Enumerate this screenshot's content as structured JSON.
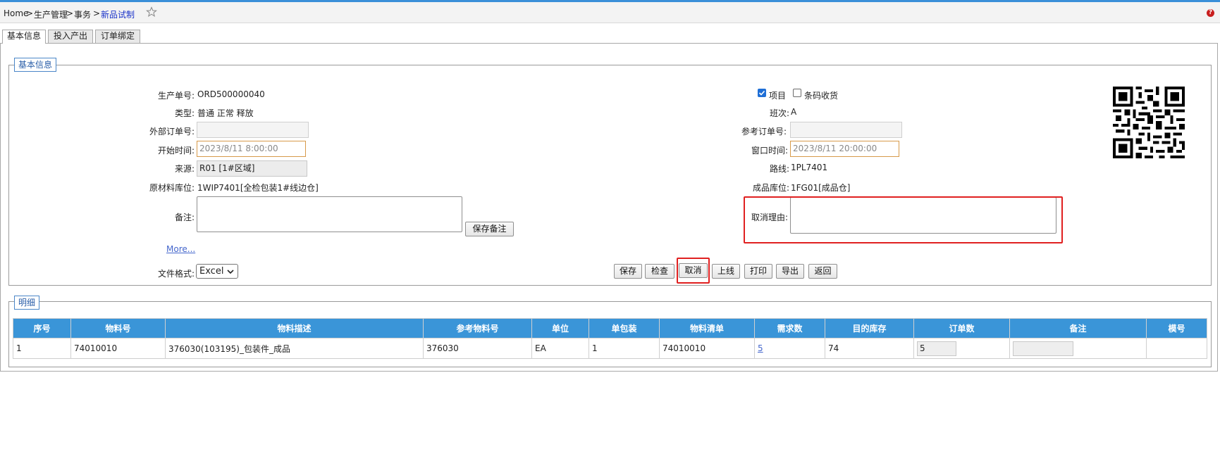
{
  "breadcrumb": {
    "home": "Home",
    "sep": ">",
    "level1": "生产管理",
    "level2": "事务",
    "current": "新品试制"
  },
  "tabs": [
    {
      "label": "基本信息",
      "active": true
    },
    {
      "label": "投入产出",
      "active": false
    },
    {
      "label": "订单绑定",
      "active": false
    }
  ],
  "basic": {
    "legend": "基本信息",
    "prod_order_label": "生产单号:",
    "prod_order": "ORD500000040",
    "type_label": "类型:",
    "type": "普通 正常 释放",
    "ext_order_label": "外部订单号:",
    "ext_order": "",
    "start_time_label": "开始时间:",
    "start_time": "2023/8/11 8:00:00",
    "source_label": "来源:",
    "source": "R01 [1#区域]",
    "raw_loc_label": "原材料库位:",
    "raw_loc": "1WIP7401[全检包装1#线边仓]",
    "remark_label": "备注:",
    "remark": "",
    "save_remark_button": "保存备注",
    "more_link": "More...",
    "file_format_label": "文件格式:",
    "file_format": "Excel",
    "project_label": "项目",
    "project_checked": true,
    "barcode_label": "条码收货",
    "barcode_checked": false,
    "shift_label": "班次:",
    "shift": "A",
    "ref_order_label": "参考订单号:",
    "ref_order": "",
    "window_time_label": "窗口时间:",
    "window_time": "2023/8/11 20:00:00",
    "route_label": "路线:",
    "route": "1PL7401",
    "fg_loc_label": "成品库位:",
    "fg_loc": "1FG01[成品仓]",
    "cancel_reason_label": "取消理由:",
    "cancel_reason": ""
  },
  "actions": {
    "save": "保存",
    "check": "检查",
    "cancel": "取消",
    "online": "上线",
    "print": "打印",
    "export": "导出",
    "back": "返回"
  },
  "detail": {
    "legend": "明细",
    "columns": [
      "序号",
      "物料号",
      "物料描述",
      "参考物料号",
      "单位",
      "单包装",
      "物料清单",
      "需求数",
      "目的库存",
      "订单数",
      "备注",
      "模号"
    ],
    "rows": [
      {
        "seq": "1",
        "item": "74010010",
        "desc": "376030(103195)_包装件_成品",
        "ref_item": "376030",
        "uom": "EA",
        "unit_pack": "1",
        "bom": "74010010",
        "req_qty": "5",
        "dest_loc": "74",
        "order_qty": "5",
        "remark": "",
        "mold": ""
      }
    ]
  },
  "colors": {
    "accent": "#3a95d8",
    "legend_text": "#2a5ea8",
    "highlight": "#e02020",
    "checkbox": "#1f6fd6"
  },
  "icons": [
    "star-icon",
    "help-icon",
    "qr-code-icon",
    "chevron-down-icon",
    "resize-grip-icon"
  ]
}
